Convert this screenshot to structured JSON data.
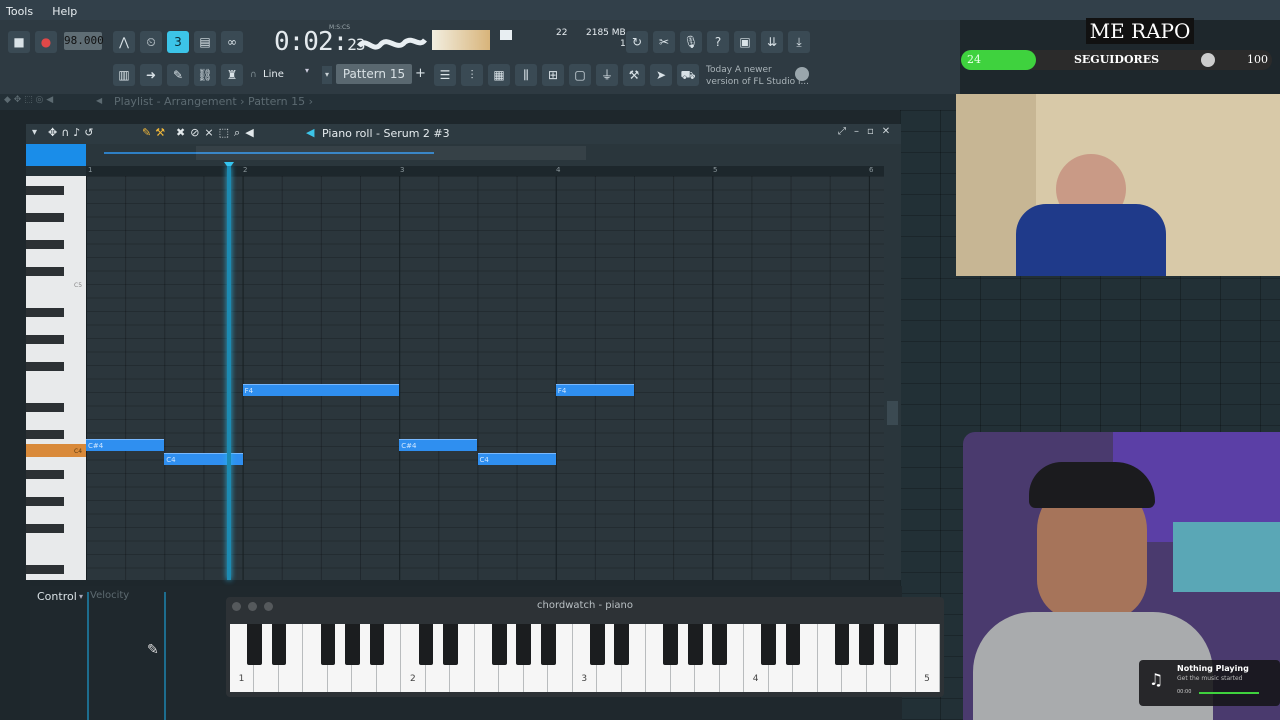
{
  "menubar": {
    "items": [
      "Tools",
      "Help"
    ]
  },
  "toolbar": {
    "tempo": "98.000",
    "time_main": "0:02:",
    "time_ticks": "23",
    "time_format": "M:S:CS",
    "cpu_value": "22",
    "mem_value": "2185 MB",
    "poly_value": "1",
    "snap_mode": "Line",
    "pattern": "Pattern 15",
    "news_line1": "Today  A newer",
    "news_line2": "version of FL Studio i..."
  },
  "crumbs": {
    "text": "Playlist - Arrangement  ›  Pattern 15 ›"
  },
  "piano_roll": {
    "title": "Piano roll - Serum 2 #3",
    "bars": [
      "1",
      "2",
      "3",
      "4",
      "5",
      "6"
    ],
    "key_labels": {
      "c5": "C5",
      "c4": "C4"
    },
    "notes": [
      {
        "label": "C#4",
        "bar": 1.0,
        "len": 0.5,
        "pitch": "C#4"
      },
      {
        "label": "C4",
        "bar": 1.5,
        "len": 0.5,
        "pitch": "C4"
      },
      {
        "label": "F4",
        "bar": 2.0,
        "len": 1.0,
        "pitch": "F4"
      },
      {
        "label": "C#4",
        "bar": 3.0,
        "len": 0.5,
        "pitch": "C#4"
      },
      {
        "label": "C4",
        "bar": 3.5,
        "len": 0.5,
        "pitch": "C4"
      },
      {
        "label": "F4",
        "bar": 4.0,
        "len": 0.5,
        "pitch": "F4"
      }
    ],
    "playhead_bar": 1.9
  },
  "control": {
    "label": "Control",
    "target": "Velocity"
  },
  "chordwatch": {
    "title": "chordwatch - piano",
    "octaves": [
      "1",
      "2",
      "3",
      "4",
      "5"
    ]
  },
  "overlay": {
    "banner": "ME RAPO",
    "followers_label": "SEGUIDORES",
    "followers_current": "24",
    "followers_goal": "100",
    "followers_progress": 0.24,
    "now_playing_title": "Nothing Playing",
    "now_playing_sub": "Get the music started",
    "now_playing_time": "00:00"
  },
  "colors": {
    "note": "#2f8ff0",
    "accent": "#3cc4e8",
    "follow_bar": "#3fd23e"
  }
}
